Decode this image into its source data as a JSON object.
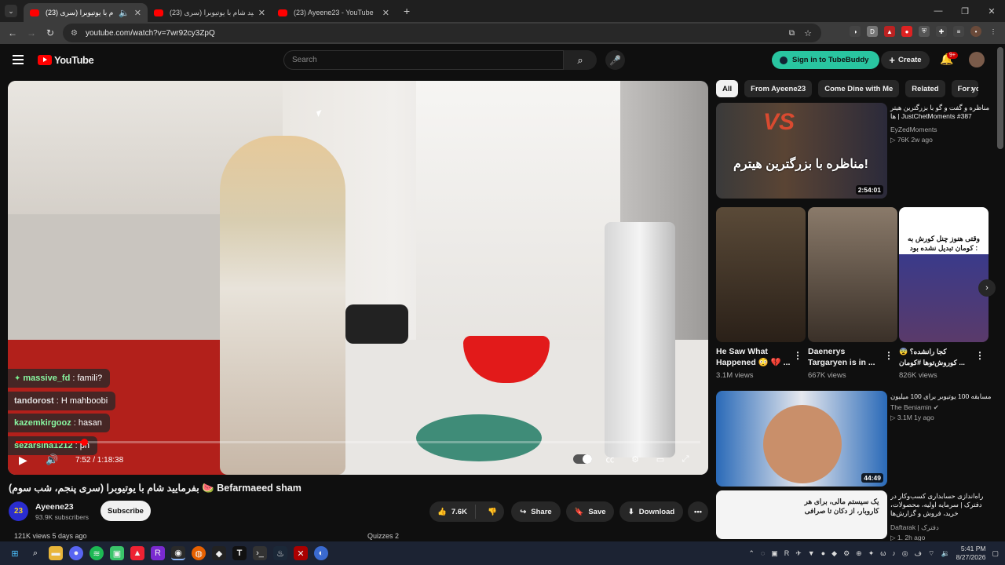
{
  "browser": {
    "tabs": [
      {
        "title": "(23) بفرمایید شام با یوتیوبرا (سری...",
        "active": true
      },
      {
        "title": "(23) بفرمایید شام با یوتیوبرا (سری...",
        "active": false
      },
      {
        "title": "(23) Ayeene23 - YouTube",
        "active": false
      }
    ],
    "url": "youtube.com/watch?v=7wr92cy3ZpQ"
  },
  "header": {
    "logo_text": "YouTube",
    "search_placeholder": "Search",
    "tubebuddy_label": "Sign in to TubeBuddy",
    "create_label": "Create",
    "notif_count": "9+"
  },
  "video": {
    "chat": [
      {
        "user": "massive_fd",
        "message": "famili?",
        "badge": true
      },
      {
        "user": "tandorost",
        "message": "H mahboobi",
        "badge": false
      },
      {
        "user": "kazemkirgooz",
        "message": "hasan",
        "badge": false
      },
      {
        "user": "sezarsina1212",
        "message": "ph",
        "badge": false
      }
    ],
    "time": "7:52 / 1:18:38",
    "progress": 0.1,
    "title": "بفرمایید شام با یوتیوبرا (سری پنجم، شب سوم) 🍉 Befarmaeed sham",
    "channel_initial": "23",
    "channel": "Ayeene23",
    "subscribers": "93.9K subscribers",
    "subscribe_label": "Subscribe",
    "likes": "7.6K",
    "share_label": "Share",
    "save_label": "Save",
    "download_label": "Download",
    "desc_stub": "121K views  5 days ago",
    "quizzes_stub": "Quizzes  2"
  },
  "sidebar": {
    "chips": [
      "All",
      "From Ayeene23",
      "Come Dine with Me",
      "Related",
      "For you"
    ],
    "recs": [
      {
        "title": "مناظره و گفت و گو با بزرگترین هیتر ها | JustChetMoments #387",
        "channel": "EyZedMoments",
        "meta": "▷ 76K   2w ago",
        "duration": "2:54:01",
        "thumb_text": "مناظره با بزرگترین هیترم!"
      },
      {
        "title": "مسابقه 100 یوتیوبر برای 100 میلیون",
        "channel": "The Beniamin ✔",
        "meta": "▷ 3.1M   1y ago",
        "duration": "44:49",
        "thumb_text": ""
      },
      {
        "title": "راه‌اندازی حسابداری کسب‌وکار در دفترک | سرمایه اولیه، محصولات، خرید، فروش و گزارش‌ها",
        "channel": "Daftarak | دفترک",
        "meta": "▷ 1.   2h ago",
        "duration": "",
        "thumb_text": "یک سیستم مالی، برای هر کاروبار، از دکان تا صرافی"
      }
    ],
    "shorts": [
      {
        "title": "He Saw What Happened 😳 💔 ...",
        "views": "3.1M views"
      },
      {
        "title": "Daenerys Targaryen is in ...",
        "views": "667K views"
      },
      {
        "title": "😨 کجا رانشده؟ کوروش‌تو‌‌ها #کومان ...",
        "views": "826K views",
        "thumb_text": "وقتی هنوز چنل کورش به کومان تبدیل نشده بود :"
      }
    ]
  },
  "taskbar": {
    "time": "5:41 PM",
    "date": "8/27/2026"
  }
}
